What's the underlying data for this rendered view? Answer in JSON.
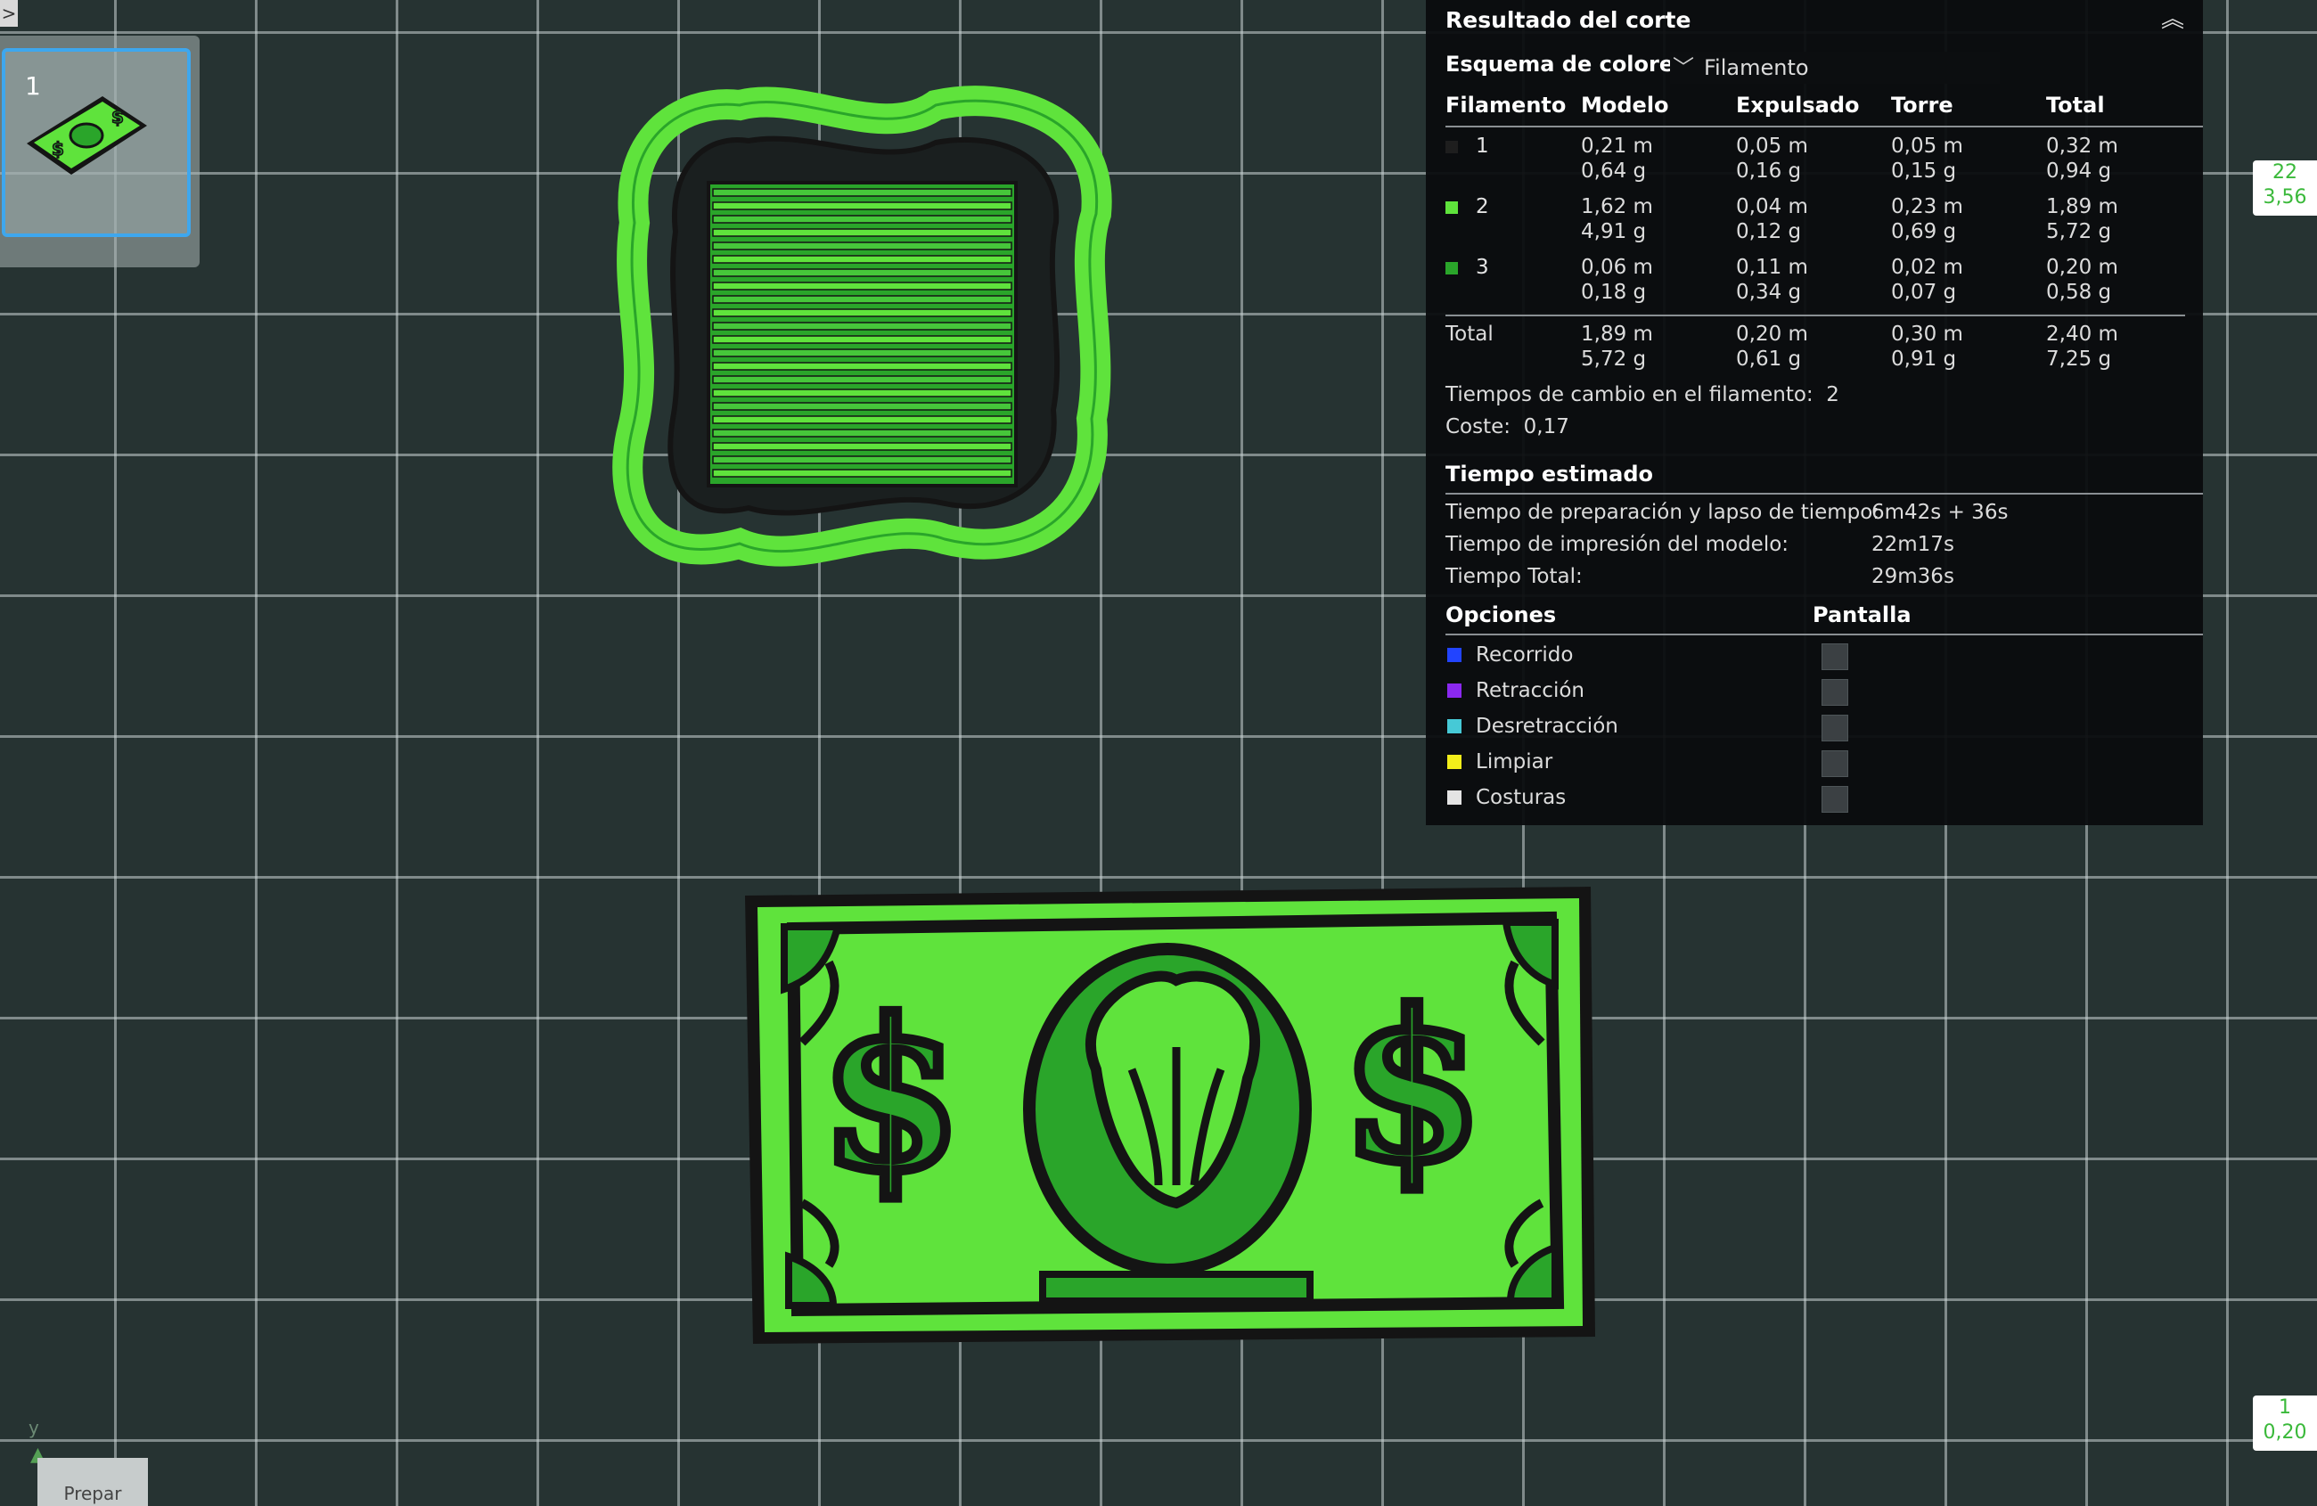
{
  "window": {
    "corner_arrow": ">"
  },
  "plate": {
    "number": "1"
  },
  "panel": {
    "title": "Resultado del corte",
    "color_scheme_label": "Esquema de colores",
    "color_scheme_value": "Filamento",
    "columns": [
      "Filamento",
      "Modelo",
      "Expulsado",
      "Torre",
      "Total"
    ],
    "filaments": [
      {
        "id": "1",
        "color": "#1e1e1e",
        "model": "0,21 m\n0,64 g",
        "purged": "0,05 m\n0,16 g",
        "tower": "0,05 m\n0,15 g",
        "total": "0,32 m\n0,94 g"
      },
      {
        "id": "2",
        "color": "#5fe33c",
        "model": "1,62 m\n4,91 g",
        "purged": "0,04 m\n0,12 g",
        "tower": "0,23 m\n0,69 g",
        "total": "1,89 m\n5,72 g"
      },
      {
        "id": "3",
        "color": "#2aa52a",
        "model": "0,06 m\n0,18 g",
        "purged": "0,11 m\n0,34 g",
        "tower": "0,02 m\n0,07 g",
        "total": "0,20 m\n0,58 g"
      }
    ],
    "totals": {
      "label": "Total",
      "model": "1,89 m\n5,72 g",
      "purged": "0,20 m\n0,61 g",
      "tower": "0,30 m\n0,91 g",
      "total": "2,40 m\n7,25 g"
    },
    "filament_changes_label": "Tiempos de cambio en el filamento:",
    "filament_changes_value": "2",
    "cost_label": "Coste:",
    "cost_value": "0,17",
    "estimated_time_title": "Tiempo estimado",
    "prep_time_label": "Tiempo de preparación y lapso de tiempo:",
    "prep_time_value": "6m42s + 36s",
    "print_time_label": "Tiempo de impresión del modelo:",
    "print_time_value": "22m17s",
    "total_time_label": "Tiempo Total:",
    "total_time_value": "29m36s",
    "options_title": "Opciones",
    "display_title": "Pantalla",
    "options": [
      {
        "label": "Recorrido",
        "color": "#2244ff"
      },
      {
        "label": "Retracción",
        "color": "#8b28f0"
      },
      {
        "label": "Desretracción",
        "color": "#46c9d6"
      },
      {
        "label": "Limpiar",
        "color": "#f2ee1a"
      },
      {
        "label": "Costuras",
        "color": "#e4e4e4"
      }
    ]
  },
  "layer_slider": {
    "top_layer": "22",
    "top_height": "3,56",
    "bottom_layer": "1",
    "bottom_height": "0,20"
  },
  "axis": {
    "y_label": "y"
  },
  "bottom_tab": {
    "label": "Prepar"
  },
  "colors": {
    "bright_green": "#5fe33c",
    "dark_green": "#2aa52a",
    "outline": "#141414"
  }
}
